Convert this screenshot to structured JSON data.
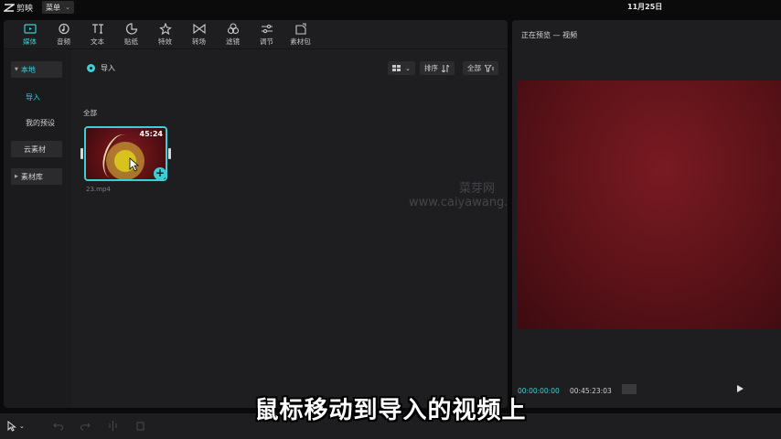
{
  "app": {
    "name": "剪映",
    "menu_label": "菜单",
    "date": "11月25日"
  },
  "toolbar": {
    "tabs": [
      {
        "label": "媒体",
        "icon": "media-icon",
        "active": true
      },
      {
        "label": "音频",
        "icon": "audio-icon"
      },
      {
        "label": "文本",
        "icon": "text-icon"
      },
      {
        "label": "贴纸",
        "icon": "sticker-icon"
      },
      {
        "label": "特效",
        "icon": "effects-icon"
      },
      {
        "label": "转场",
        "icon": "transition-icon"
      },
      {
        "label": "滤镜",
        "icon": "filter-icon"
      },
      {
        "label": "调节",
        "icon": "adjust-icon"
      },
      {
        "label": "素材包",
        "icon": "package-icon"
      }
    ]
  },
  "sidebar": {
    "local": "本地",
    "import": "导入",
    "presets": "我的预设",
    "cloud": "云素材",
    "library": "素材库"
  },
  "content": {
    "import_label": "导入",
    "sort_label": "排序",
    "filter_label": "全部",
    "all_label": "全部",
    "media": {
      "duration": "45:24",
      "filename": "23.mp4"
    }
  },
  "watermark": {
    "line1": "菜芽网",
    "line2": "www.caiyawang.com"
  },
  "preview": {
    "title": "正在预览 — 视频",
    "current_time": "00:00:00:00",
    "total_time": "00:45:23:03"
  },
  "subtitle": "鼠标移动到导入的视频上",
  "colors": {
    "accent": "#3ad0d6",
    "panel": "#1e1e20",
    "video_red": "#6a151b"
  }
}
